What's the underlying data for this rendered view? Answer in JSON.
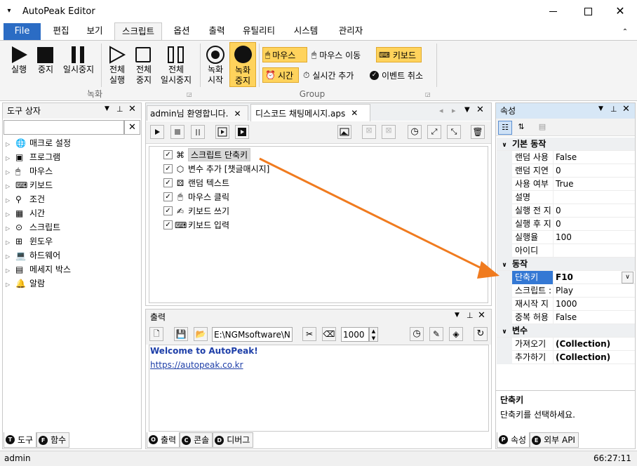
{
  "window": {
    "title": "AutoPeak Editor"
  },
  "menu": {
    "file": "File",
    "tabs": [
      "편집",
      "보기",
      "스크립트",
      "옵션",
      "출력",
      "유틸리티",
      "시스템",
      "관리자"
    ]
  },
  "ribbon": {
    "record_group": {
      "label": "녹화",
      "buttons": [
        "실행",
        "중지",
        "일시중지",
        "전체\n실행",
        "전체\n중지",
        "전체\n일시중지",
        "녹화\n시작",
        "녹화\n중지"
      ]
    },
    "group": {
      "label": "Group",
      "items": [
        "마우스",
        "마우스 이동",
        "키보드",
        "시간",
        "실시간 추가",
        "이벤트 취소"
      ]
    }
  },
  "toolbox": {
    "title": "도구 상자",
    "items": [
      "매크로 설정",
      "프로그램",
      "마우스",
      "키보드",
      "조건",
      "시간",
      "스크립트",
      "윈도우",
      "하드웨어",
      "메세지 박스",
      "알람"
    ],
    "tabs": [
      "도구",
      "함수"
    ]
  },
  "documents": {
    "tabs": [
      "admin님 환영합니다.",
      "디스코드 채팅메시지.aps"
    ],
    "script_items": [
      "스크립트 단축키",
      "변수 추가 [챗글매시지]",
      "랜덤 텍스트",
      "마우스 클릭",
      "키보드 쓰기",
      "키보드 입력"
    ]
  },
  "output": {
    "title": "출력",
    "path": "E:\\NGMsoftware\\NG",
    "number": "1000",
    "lines": [
      "Welcome to AutoPeak!",
      "https://autopeak.co.kr"
    ],
    "tabs": [
      "출력",
      "콘솔",
      "디버그"
    ]
  },
  "properties": {
    "title": "속성",
    "categories": [
      {
        "name": "기본 동작",
        "rows": [
          [
            "랜덤 사용",
            "False"
          ],
          [
            "랜덤 지연",
            "0"
          ],
          [
            "사용 여부",
            "True"
          ],
          [
            "설명",
            ""
          ],
          [
            "실행 전 지",
            "0"
          ],
          [
            "실행 후 지",
            "0"
          ],
          [
            "실행율",
            "100"
          ],
          [
            "아이디",
            ""
          ]
        ]
      },
      {
        "name": "동작",
        "rows": [
          [
            "단축키",
            "F10"
          ],
          [
            "스크립트 :",
            "Play"
          ],
          [
            "재시작 지",
            "1000"
          ],
          [
            "중복 허용",
            "False"
          ]
        ]
      },
      {
        "name": "변수",
        "rows": [
          [
            "가져오기",
            "(Collection)"
          ],
          [
            "추가하기",
            "(Collection)"
          ]
        ]
      }
    ],
    "desc_title": "단축키",
    "desc_text": "단축키를 선택하세요.",
    "tabs": [
      "속성",
      "외부 API"
    ]
  },
  "status": {
    "user": "admin",
    "time": "66:27:11"
  },
  "colors": {
    "accent": "#2b6cc4",
    "arrow": "#f07b1f",
    "highlight": "#ffd35c",
    "selected": "#3478d4"
  }
}
